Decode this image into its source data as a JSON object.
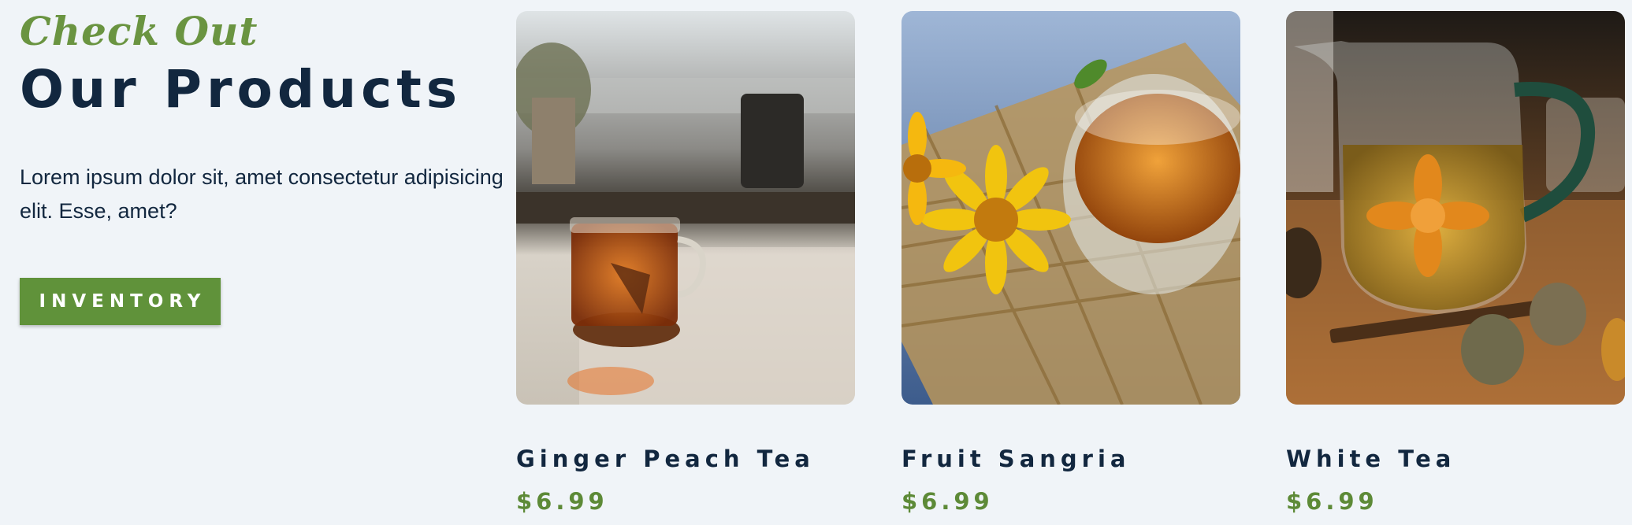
{
  "intro": {
    "eyebrow": "Check Out",
    "title": "Our Products",
    "description": "Lorem ipsum dolor sit, amet consectetur adipisicing elit. Esse, amet?",
    "button_label": "INVENTORY"
  },
  "products": [
    {
      "name": "Ginger Peach Tea",
      "price": "$6.99",
      "image": "tea-cup-on-windowsill"
    },
    {
      "name": "Fruit Sangria",
      "price": "$6.99",
      "image": "tea-cup-with-yellow-flowers"
    },
    {
      "name": "White Tea",
      "price": "$6.99",
      "image": "glass-teapot-with-flower-tea"
    }
  ],
  "colors": {
    "background": "#f0f4f8",
    "accent_green": "#60923a",
    "dark_navy": "#12273f"
  }
}
